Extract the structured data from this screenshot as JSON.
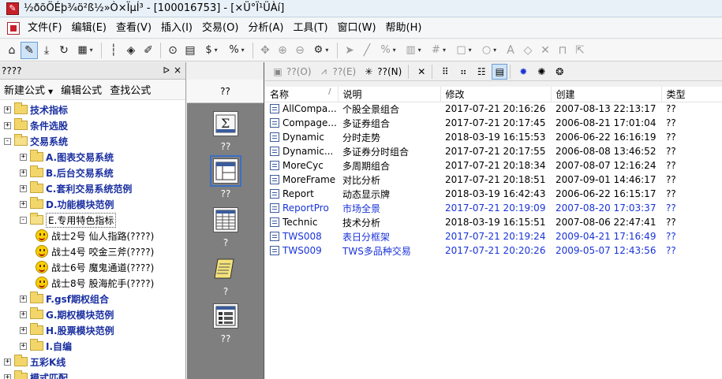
{
  "titlebar": {
    "title": "½ðõÖÉþ¾ö²ß½»Ò×ÏµÍ³ - [100016753] - [×Ü°Ï¹ÜÀí]"
  },
  "menu": {
    "items": [
      "文件(F)",
      "编辑(E)",
      "查看(V)",
      "插入(I)",
      "交易(O)",
      "分析(A)",
      "工具(T)",
      "窗口(W)",
      "帮助(H)"
    ]
  },
  "toolbar": {
    "icons": [
      "home-icon",
      "pencil-icon",
      "download-icon",
      "refresh-icon",
      "grid-icon",
      "candlestick-icon",
      "alert-icon",
      "edit-icon",
      "play-icon",
      "document-icon",
      "dollar-icon",
      "percent-icon",
      "move-icon",
      "zoom-in-icon",
      "zoom-out-icon",
      "settings-icon",
      "pointer-icon",
      "line-icon",
      "ruler-icon",
      "hash-icon",
      "square-icon",
      "circle-icon",
      "text-icon",
      "eraser-icon",
      "close-icon",
      "lock-icon",
      "expand-icon"
    ]
  },
  "leftpane": {
    "header_title": "????",
    "pin": "ᐅ",
    "close": "×",
    "links": [
      "新建公式",
      "编辑公式",
      "查找公式"
    ],
    "tree": [
      {
        "label": "技术指标",
        "level": 0,
        "type": "folder",
        "expander": "+"
      },
      {
        "label": "条件选股",
        "level": 0,
        "type": "folder",
        "expander": "+"
      },
      {
        "label": "交易系统",
        "level": 0,
        "type": "folder-open",
        "expander": "-"
      },
      {
        "label": "A.图表交易系统",
        "level": 1,
        "type": "folder",
        "expander": "+"
      },
      {
        "label": "B.后台交易系统",
        "level": 1,
        "type": "folder",
        "expander": "+"
      },
      {
        "label": "C.套利交易系统范例",
        "level": 1,
        "type": "folder",
        "expander": "+"
      },
      {
        "label": "D.功能模块范例",
        "level": 1,
        "type": "folder",
        "expander": "+"
      },
      {
        "label": "E.专用特色指标",
        "level": 1,
        "type": "folder-open",
        "expander": "-",
        "selected": true
      },
      {
        "label": "战士2号   仙人指路(????)",
        "level": 2,
        "type": "smiley"
      },
      {
        "label": "战士4号   咬金三斧(????)",
        "level": 2,
        "type": "smiley"
      },
      {
        "label": "战士6号   魔鬼通道(????)",
        "level": 2,
        "type": "smiley"
      },
      {
        "label": "战士8号   股海舵手(????)",
        "level": 2,
        "type": "smiley"
      },
      {
        "label": "F.gsf期权组合",
        "level": 1,
        "type": "folder",
        "expander": "+"
      },
      {
        "label": "G.期权模块范例",
        "level": 1,
        "type": "folder",
        "expander": "+"
      },
      {
        "label": "H.股票模块范例",
        "level": 1,
        "type": "folder",
        "expander": "+"
      },
      {
        "label": "I.自编",
        "level": 1,
        "type": "folder",
        "expander": "+"
      },
      {
        "label": "五彩K线",
        "level": 0,
        "type": "folder",
        "expander": "+"
      },
      {
        "label": "模式匹配",
        "level": 0,
        "type": "folder",
        "expander": "+"
      }
    ]
  },
  "midpane": {
    "top_label": "??",
    "items": [
      {
        "caption": "??",
        "icon": "formula-icon"
      },
      {
        "caption": "??",
        "icon": "layout-icon",
        "selected": true
      },
      {
        "caption": "?",
        "icon": "table-icon"
      },
      {
        "caption": "?",
        "icon": "scroll-icon"
      },
      {
        "caption": "??",
        "icon": "list-icon"
      }
    ]
  },
  "rightpane": {
    "toolbar": [
      {
        "label": "??(O)",
        "icon": "open-icon",
        "enabled": false
      },
      {
        "label": "??(E)",
        "icon": "chart-edit-icon",
        "enabled": false
      },
      {
        "label": "??(N)",
        "icon": "new-icon",
        "enabled": true
      }
    ],
    "columns": [
      "名称",
      "说明",
      "修改",
      "创建",
      "类型"
    ],
    "rows": [
      {
        "name": "AllCompa...",
        "desc": "个股全景组合",
        "modified": "2017-07-21 20:16:26",
        "created": "2007-08-13 22:13:17",
        "type": "??",
        "blue": false
      },
      {
        "name": "Compage...",
        "desc": "多证券组合",
        "modified": "2017-07-21 20:17:45",
        "created": "2006-08-21 17:01:04",
        "type": "??",
        "blue": false
      },
      {
        "name": "Dynamic",
        "desc": "分时走势",
        "modified": "2018-03-19 16:15:53",
        "created": "2006-06-22 16:16:19",
        "type": "??",
        "blue": false
      },
      {
        "name": "Dynamic...",
        "desc": "多证券分时组合",
        "modified": "2017-07-21 20:17:55",
        "created": "2006-08-08 13:46:52",
        "type": "??",
        "blue": false
      },
      {
        "name": "MoreCyc",
        "desc": "多周期组合",
        "modified": "2017-07-21 20:18:34",
        "created": "2007-08-07 12:16:24",
        "type": "??",
        "blue": false
      },
      {
        "name": "MoreFrame",
        "desc": "对比分析",
        "modified": "2017-07-21 20:18:51",
        "created": "2007-09-01 14:46:17",
        "type": "??",
        "blue": false
      },
      {
        "name": "Report",
        "desc": "动态显示牌",
        "modified": "2018-03-19 16:42:43",
        "created": "2006-06-22 16:15:17",
        "type": "??",
        "blue": false
      },
      {
        "name": "ReportPro",
        "desc": "市场全景",
        "modified": "2017-07-21 20:19:09",
        "created": "2007-08-20 17:03:37",
        "type": "??",
        "blue": true
      },
      {
        "name": "Technic",
        "desc": "技术分析",
        "modified": "2018-03-19 16:15:51",
        "created": "2007-08-06 22:47:41",
        "type": "??",
        "blue": false
      },
      {
        "name": "TWS008",
        "desc": "表日分框架",
        "modified": "2017-07-21 20:19:24",
        "created": "2009-04-21 17:16:49",
        "type": "??",
        "blue": true
      },
      {
        "name": "TWS009",
        "desc": "TWS多品种交易",
        "modified": "2017-07-21 20:20:26",
        "created": "2009-05-07 12:43:56",
        "type": "??",
        "blue": true
      }
    ]
  },
  "colors": {
    "tree_label": "#1a2fa0",
    "blue_row": "#1a33d8",
    "mid_bg": "#7f7f7f"
  }
}
